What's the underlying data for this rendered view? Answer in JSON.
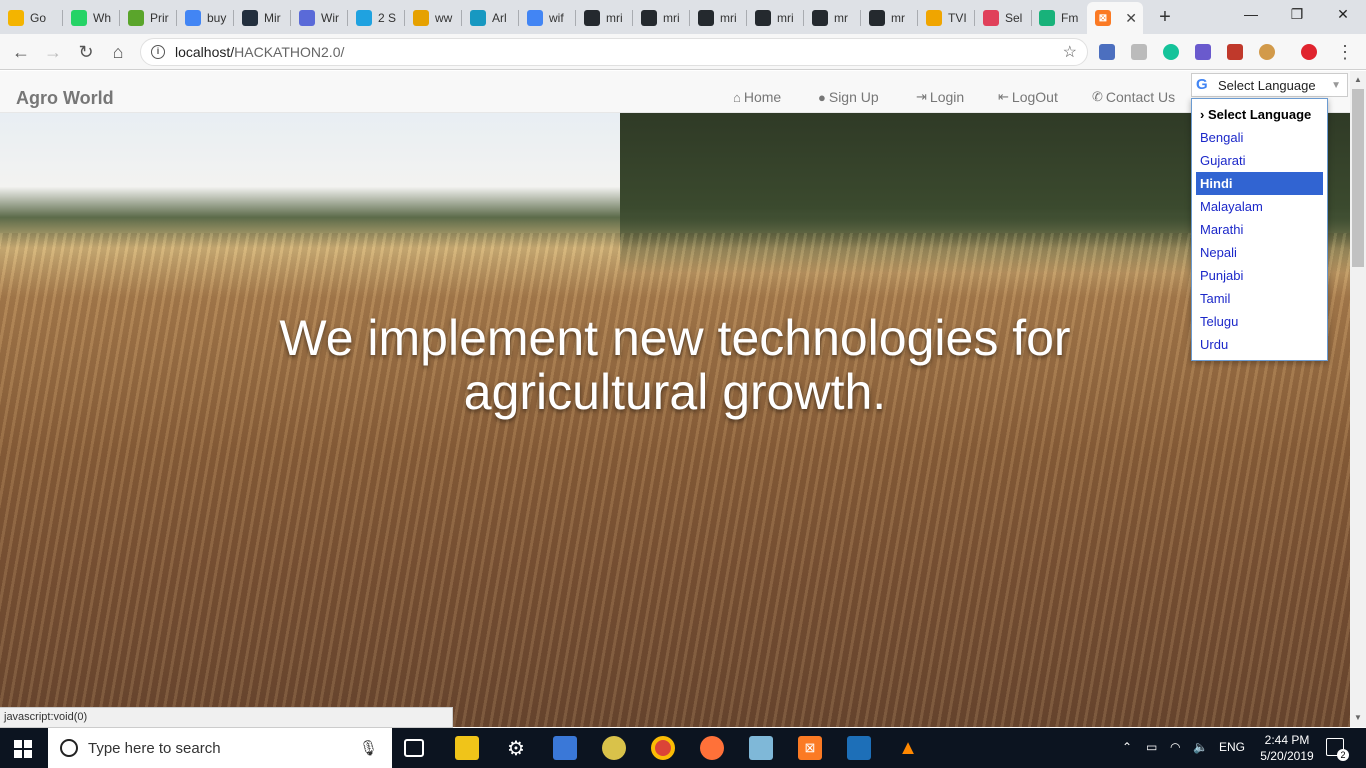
{
  "browser": {
    "tabs": [
      {
        "label": "Go",
        "icon": "bulb-icon",
        "color": "#f4b400"
      },
      {
        "label": "Wh",
        "icon": "whatsapp-icon",
        "color": "#25d366"
      },
      {
        "label": "Prir",
        "icon": "play-icon",
        "color": "#5aa52b"
      },
      {
        "label": "buy",
        "icon": "google-icon",
        "color": "#4285f4"
      },
      {
        "label": "Mir",
        "icon": "amazon-icon",
        "color": "#232f3e"
      },
      {
        "label": "Wir",
        "icon": "shield-icon",
        "color": "#5a6ad8"
      },
      {
        "label": "2 S",
        "icon": "chat-icon",
        "color": "#1fa2e0"
      },
      {
        "label": "ww",
        "icon": "w-icon",
        "color": "#e6a100"
      },
      {
        "label": "Arl",
        "icon": "cloud-icon",
        "color": "#1798c1"
      },
      {
        "label": "wif",
        "icon": "google-icon",
        "color": "#4285f4"
      },
      {
        "label": "mri",
        "icon": "github-icon",
        "color": "#24292e"
      },
      {
        "label": "mri",
        "icon": "github-icon",
        "color": "#24292e"
      },
      {
        "label": "mri",
        "icon": "github-icon",
        "color": "#24292e"
      },
      {
        "label": "mri",
        "icon": "github-icon",
        "color": "#24292e"
      },
      {
        "label": "mr",
        "icon": "github-icon",
        "color": "#24292e"
      },
      {
        "label": "mr",
        "icon": "github-icon",
        "color": "#24292e"
      },
      {
        "label": "TVI",
        "icon": "tv-icon",
        "color": "#f0a500"
      },
      {
        "label": "Sel",
        "icon": "heart-icon",
        "color": "#e0405a"
      },
      {
        "label": "Fm",
        "icon": "play-circle-icon",
        "color": "#18b27a"
      }
    ],
    "active_tab_icon": "xampp-icon",
    "address": {
      "host": "localhost/",
      "path": "HACKATHON2.0/"
    }
  },
  "site": {
    "brand": "Agro World",
    "nav": [
      {
        "label": "Home",
        "icon": "home-icon",
        "glyph": "⌂"
      },
      {
        "label": "Sign Up",
        "icon": "user-icon",
        "glyph": "👤"
      },
      {
        "label": "Login",
        "icon": "login-icon",
        "glyph": "⇥"
      },
      {
        "label": "LogOut",
        "icon": "logout-icon",
        "glyph": "⇤"
      },
      {
        "label": "Contact Us",
        "icon": "phone-icon",
        "glyph": "✆"
      }
    ],
    "language": {
      "selected_label": "Select Language",
      "options": [
        "› Select Language",
        "Bengali",
        "Gujarati",
        "Hindi",
        "Malayalam",
        "Marathi",
        "Nepali",
        "Punjabi",
        "Tamil",
        "Telugu",
        "Urdu"
      ],
      "highlighted": "Hindi"
    },
    "hero_title": "We implement new technologies for agricultural growth."
  },
  "status_bar": "javascript:void(0)",
  "taskbar": {
    "search_placeholder": "Type here to search",
    "lang": "ENG",
    "time": "2:44 PM",
    "date": "5/20/2019",
    "notifications": "2"
  }
}
